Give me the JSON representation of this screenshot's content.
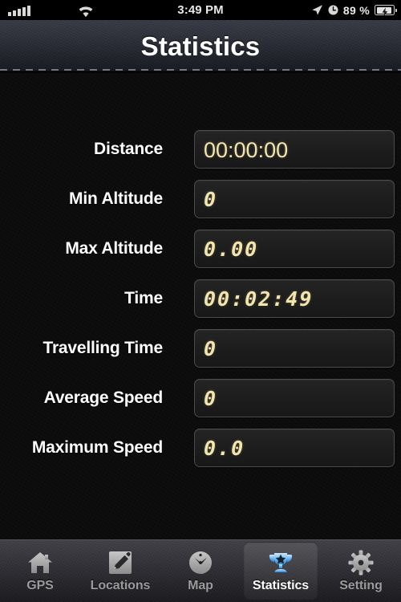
{
  "status_bar": {
    "signal_icon": "cellular-signal-bars",
    "signal_bars_filled": 5,
    "wifi_icon": "wifi-icon",
    "time": "3:49 PM",
    "location_icon": "location-arrow-icon",
    "alarm_icon": "alarm-clock-icon",
    "battery_percent": "89 %",
    "battery_icon": "battery-charging-icon"
  },
  "navbar": {
    "title": "Statistics"
  },
  "stats": {
    "rows": [
      {
        "label": "Distance",
        "value": "00:00:00",
        "style": "round"
      },
      {
        "label": "Min Altitude",
        "value": "0",
        "style": "lcd"
      },
      {
        "label": "Max Altitude",
        "value": "0.00",
        "style": "lcd"
      },
      {
        "label": "Time",
        "value": "00:02:49",
        "style": "lcd"
      },
      {
        "label": "Travelling Time",
        "value": "0",
        "style": "lcd"
      },
      {
        "label": "Average Speed",
        "value": "0",
        "style": "lcd"
      },
      {
        "label": "Maximum Speed",
        "value": "0.0",
        "style": "lcd"
      }
    ]
  },
  "tabbar": {
    "active_index": 3,
    "items": [
      {
        "label": "GPS",
        "icon": "home-icon"
      },
      {
        "label": "Locations",
        "icon": "pencil-edit-icon"
      },
      {
        "label": "Map",
        "icon": "compass-clock-icon"
      },
      {
        "label": "Statistics",
        "icon": "trophy-icon"
      },
      {
        "label": "Setting",
        "icon": "gear-icon"
      }
    ]
  },
  "colors": {
    "value_text": "#f2e5ad",
    "label_text": "#ffffff",
    "tab_inactive": "#9b9b9b",
    "tab_active": "#ffffff",
    "trophy_blue": "#4aa8f0",
    "background": "#0b0b0b"
  }
}
